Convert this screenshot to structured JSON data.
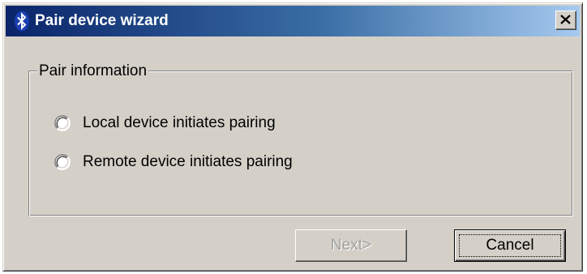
{
  "window": {
    "title": "Pair device wizard",
    "title_icon": "bluetooth-icon",
    "close_icon": "close-icon"
  },
  "group": {
    "label": "Pair information",
    "options": [
      {
        "label": "Local device initiates pairing",
        "selected": false
      },
      {
        "label": "Remote device initiates pairing",
        "selected": false
      }
    ]
  },
  "buttons": {
    "next_label": "Next>",
    "next_enabled": false,
    "cancel_label": "Cancel",
    "cancel_default": true
  },
  "colors": {
    "title_gradient_start": "#0a246a",
    "title_gradient_end": "#a6caf0",
    "face": "#d4d0c8",
    "disabled_text": "#a0a0a0"
  }
}
